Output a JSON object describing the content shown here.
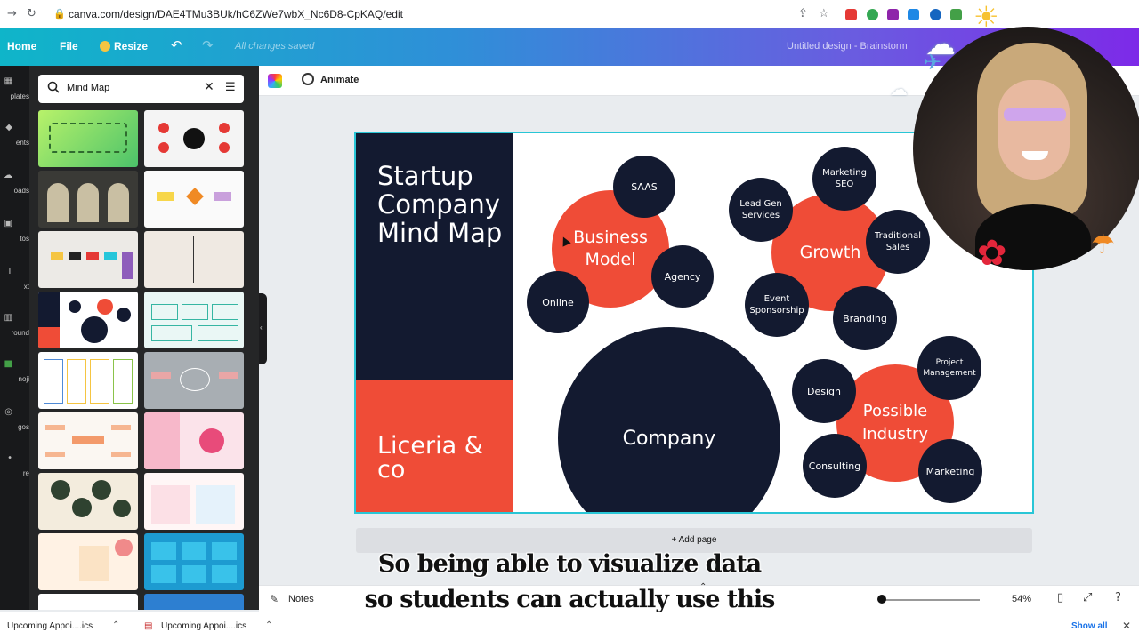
{
  "browser": {
    "url": "canva.com/design/DAE4TMu3BUk/hC6ZWe7wbX_Nc6D8-CpKAQ/edit"
  },
  "header": {
    "home": "Home",
    "file": "File",
    "resize": "Resize",
    "saved_status": "All changes saved",
    "design_title": "Untitled design - Brainstorm"
  },
  "rail": {
    "items": [
      "plates",
      "ents",
      "oads",
      "tos",
      "xt",
      "round",
      "noji",
      "gos",
      "re"
    ]
  },
  "search": {
    "query": "Mind Map"
  },
  "toolbar": {
    "animate": "Animate"
  },
  "design": {
    "title": "Startup Company Mind Map",
    "brand": "Liceria & co",
    "colors": {
      "navy": "#131a30",
      "red": "#ef4c37",
      "selection": "#29c6d6"
    },
    "hubs": {
      "business_model": "Business Model",
      "growth": "Growth",
      "possible_industry": "Possible Industry",
      "company": "Company"
    },
    "nodes": {
      "saas": "SAAS",
      "agency": "Agency",
      "online": "Online",
      "lead_gen": "Lead Gen Services",
      "marketing_seo": "Marketing SEO",
      "traditional_sales": "Traditional Sales",
      "event_sponsorship": "Event Sponsorship",
      "branding": "Branding",
      "design": "Design",
      "project_management": "Project Management",
      "consulting": "Consulting",
      "marketing": "Marketing"
    }
  },
  "add_page": "+ Add page",
  "bottombar": {
    "notes": "Notes",
    "zoom": "54%"
  },
  "downloads": {
    "item1": "Upcoming Appoi....ics",
    "item2": "Upcoming Appoi....ics",
    "show_all": "Show all"
  },
  "caption": {
    "line1": "So being able to visualize data",
    "line2": "so students can actually use this"
  }
}
